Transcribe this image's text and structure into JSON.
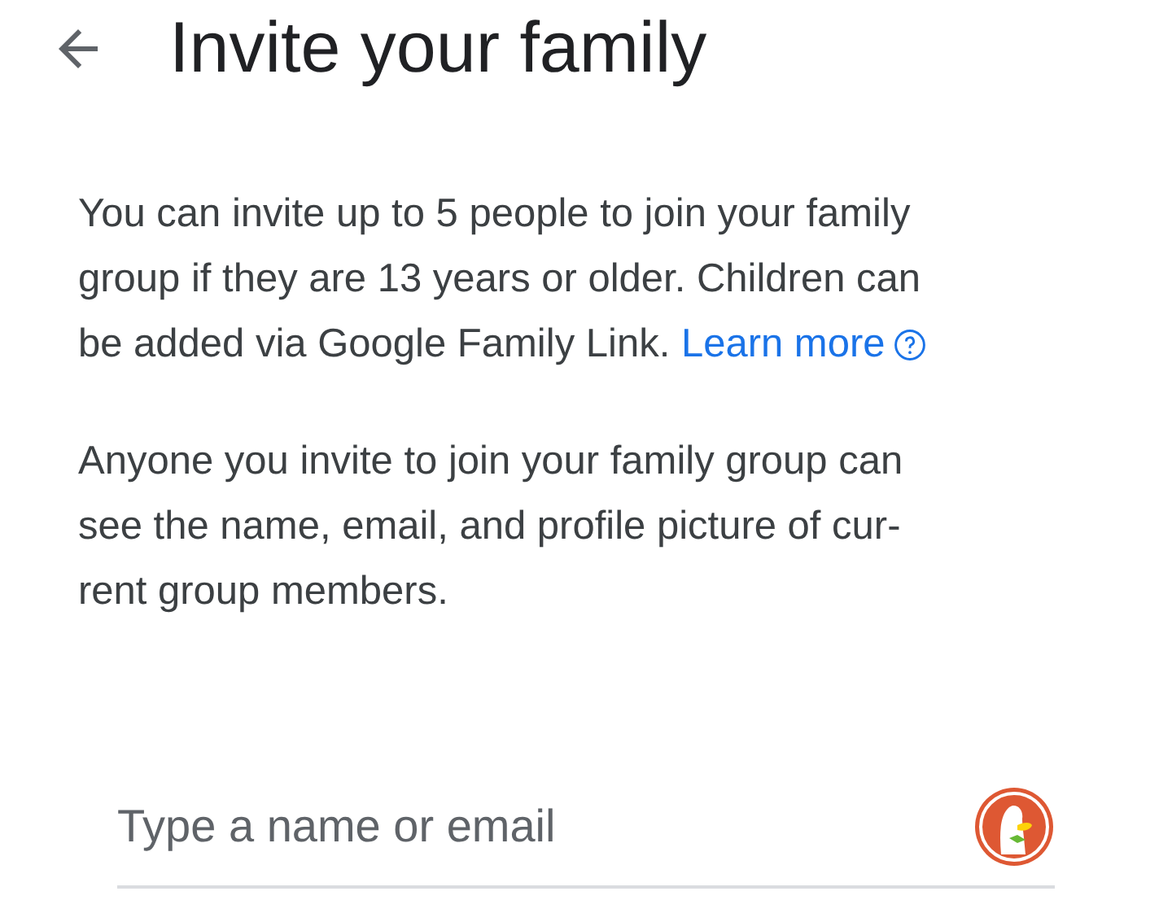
{
  "header": {
    "title": "Invite your family"
  },
  "intro": {
    "lines": [
      "You can invite up to 5 people to join your family",
      "group if they are 13 years or older. Children can",
      "be added via Google Family Link."
    ],
    "link": "Learn more"
  },
  "notice": {
    "lines": [
      "Anyone you invite to join your family group can",
      "see the name, email, and profile picture of cur-",
      "rent group members."
    ]
  },
  "invite_field": {
    "placeholder": "Type a name or email"
  }
}
